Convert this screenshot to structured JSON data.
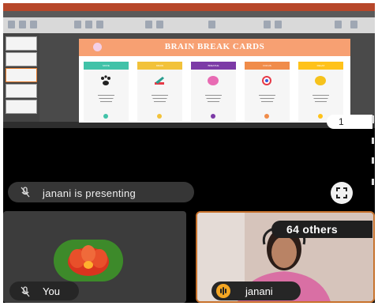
{
  "slide": {
    "title": "BRAIN BREAK CARDS",
    "cards": [
      {
        "label": "MOVE",
        "color": "#41c2a8",
        "dot": "#41c2a8",
        "icon": "paw-icon"
      },
      {
        "label": "DRAW",
        "color": "#f2c23a",
        "dot": "#f2c23a",
        "icon": "pencil-icon"
      },
      {
        "label": "BREATHE",
        "color": "#7c3aa6",
        "dot": "#7c3aa6",
        "icon": "bubble-icon"
      },
      {
        "label": "FOCUS",
        "color": "#f08c4a",
        "dot": "#f08c4a",
        "icon": "target-icon"
      },
      {
        "label": "RELAX",
        "color": "#ffc21a",
        "dot": "#ffc21a",
        "icon": "heart-icon"
      }
    ]
  },
  "share": {
    "page_number": "1"
  },
  "presenting": {
    "text": "janani is presenting"
  },
  "tiles": {
    "you_label": "You",
    "janani_label": "janani",
    "others_label": "64 others"
  },
  "colors": {
    "background": "#000000",
    "chip": "#363636",
    "accent": "#c8722c"
  }
}
